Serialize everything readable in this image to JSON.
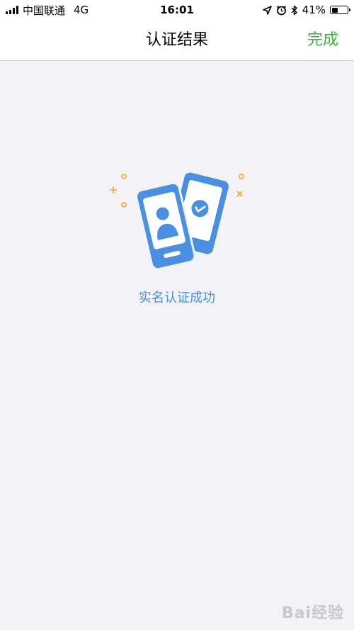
{
  "status_bar": {
    "carrier": "中国联通",
    "network": "4G",
    "time": "16:01",
    "battery_text": "41%",
    "battery_level": 0.41
  },
  "nav": {
    "title": "认证结果",
    "done_label": "完成"
  },
  "main": {
    "illustration_icon": "id-card-verified-icon",
    "success_message": "实名认证成功"
  },
  "watermark": {
    "text": "Bai经验"
  },
  "colors": {
    "accent_green": "#34b634",
    "illustration_blue": "#4a90e2",
    "decor_orange": "#f5a623",
    "background": "#f2f2f7"
  }
}
